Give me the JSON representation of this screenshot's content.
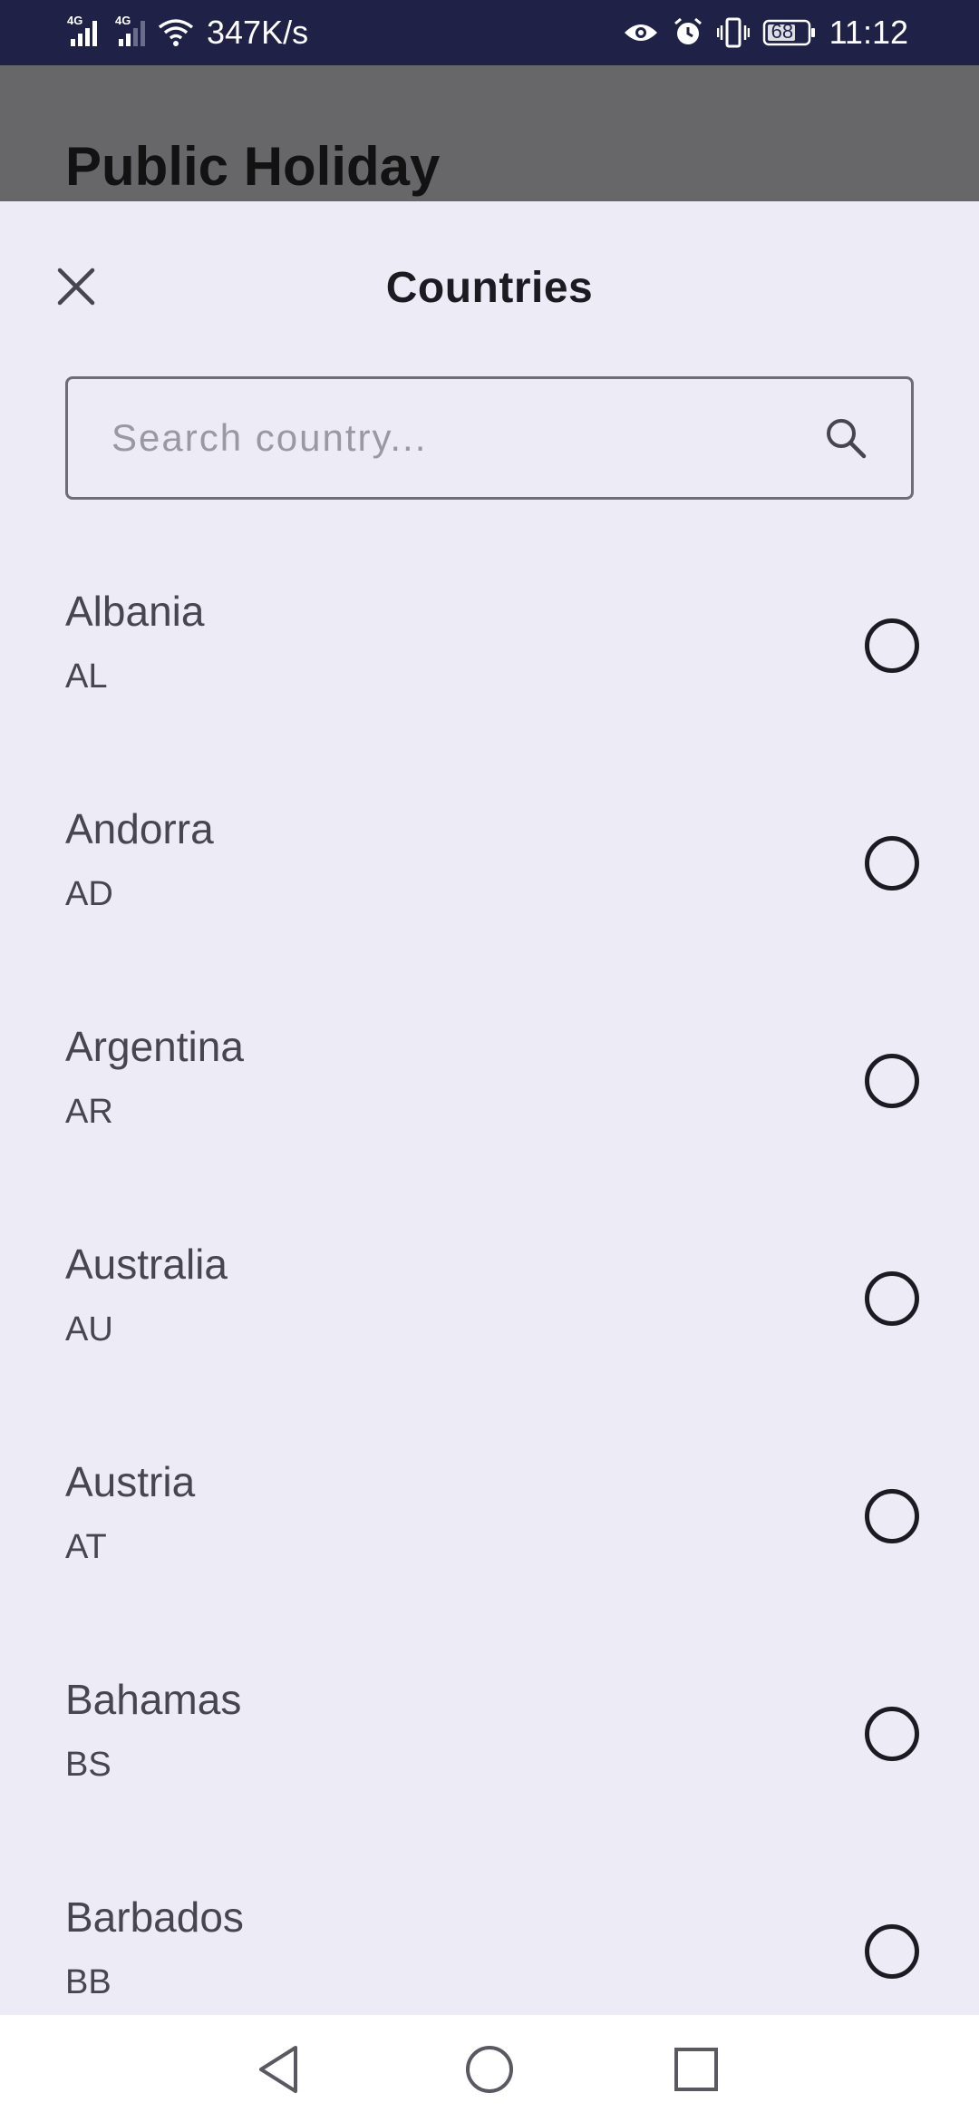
{
  "status_bar": {
    "network_speed": "347K/s",
    "signal_1_label": "4G",
    "signal_2_label": "4G",
    "battery": "68",
    "time": "11:12",
    "icons": [
      "signal-icon",
      "wifi-icon",
      "eye-icon",
      "alarm-icon",
      "vibrate-icon",
      "battery-icon"
    ]
  },
  "background_page": {
    "title": "Public Holiday"
  },
  "sheet": {
    "title": "Countries",
    "close_icon": "close-icon",
    "search": {
      "placeholder": "Search country...",
      "value": "",
      "icon": "search-icon"
    },
    "countries": [
      {
        "name": "Albania",
        "code": "AL",
        "selected": false
      },
      {
        "name": "Andorra",
        "code": "AD",
        "selected": false
      },
      {
        "name": "Argentina",
        "code": "AR",
        "selected": false
      },
      {
        "name": "Australia",
        "code": "AU",
        "selected": false
      },
      {
        "name": "Austria",
        "code": "AT",
        "selected": false
      },
      {
        "name": "Bahamas",
        "code": "BS",
        "selected": false
      },
      {
        "name": "Barbados",
        "code": "BB",
        "selected": false
      }
    ]
  },
  "nav_bar": {
    "icons": [
      "back-icon",
      "home-icon",
      "recents-icon"
    ]
  }
}
